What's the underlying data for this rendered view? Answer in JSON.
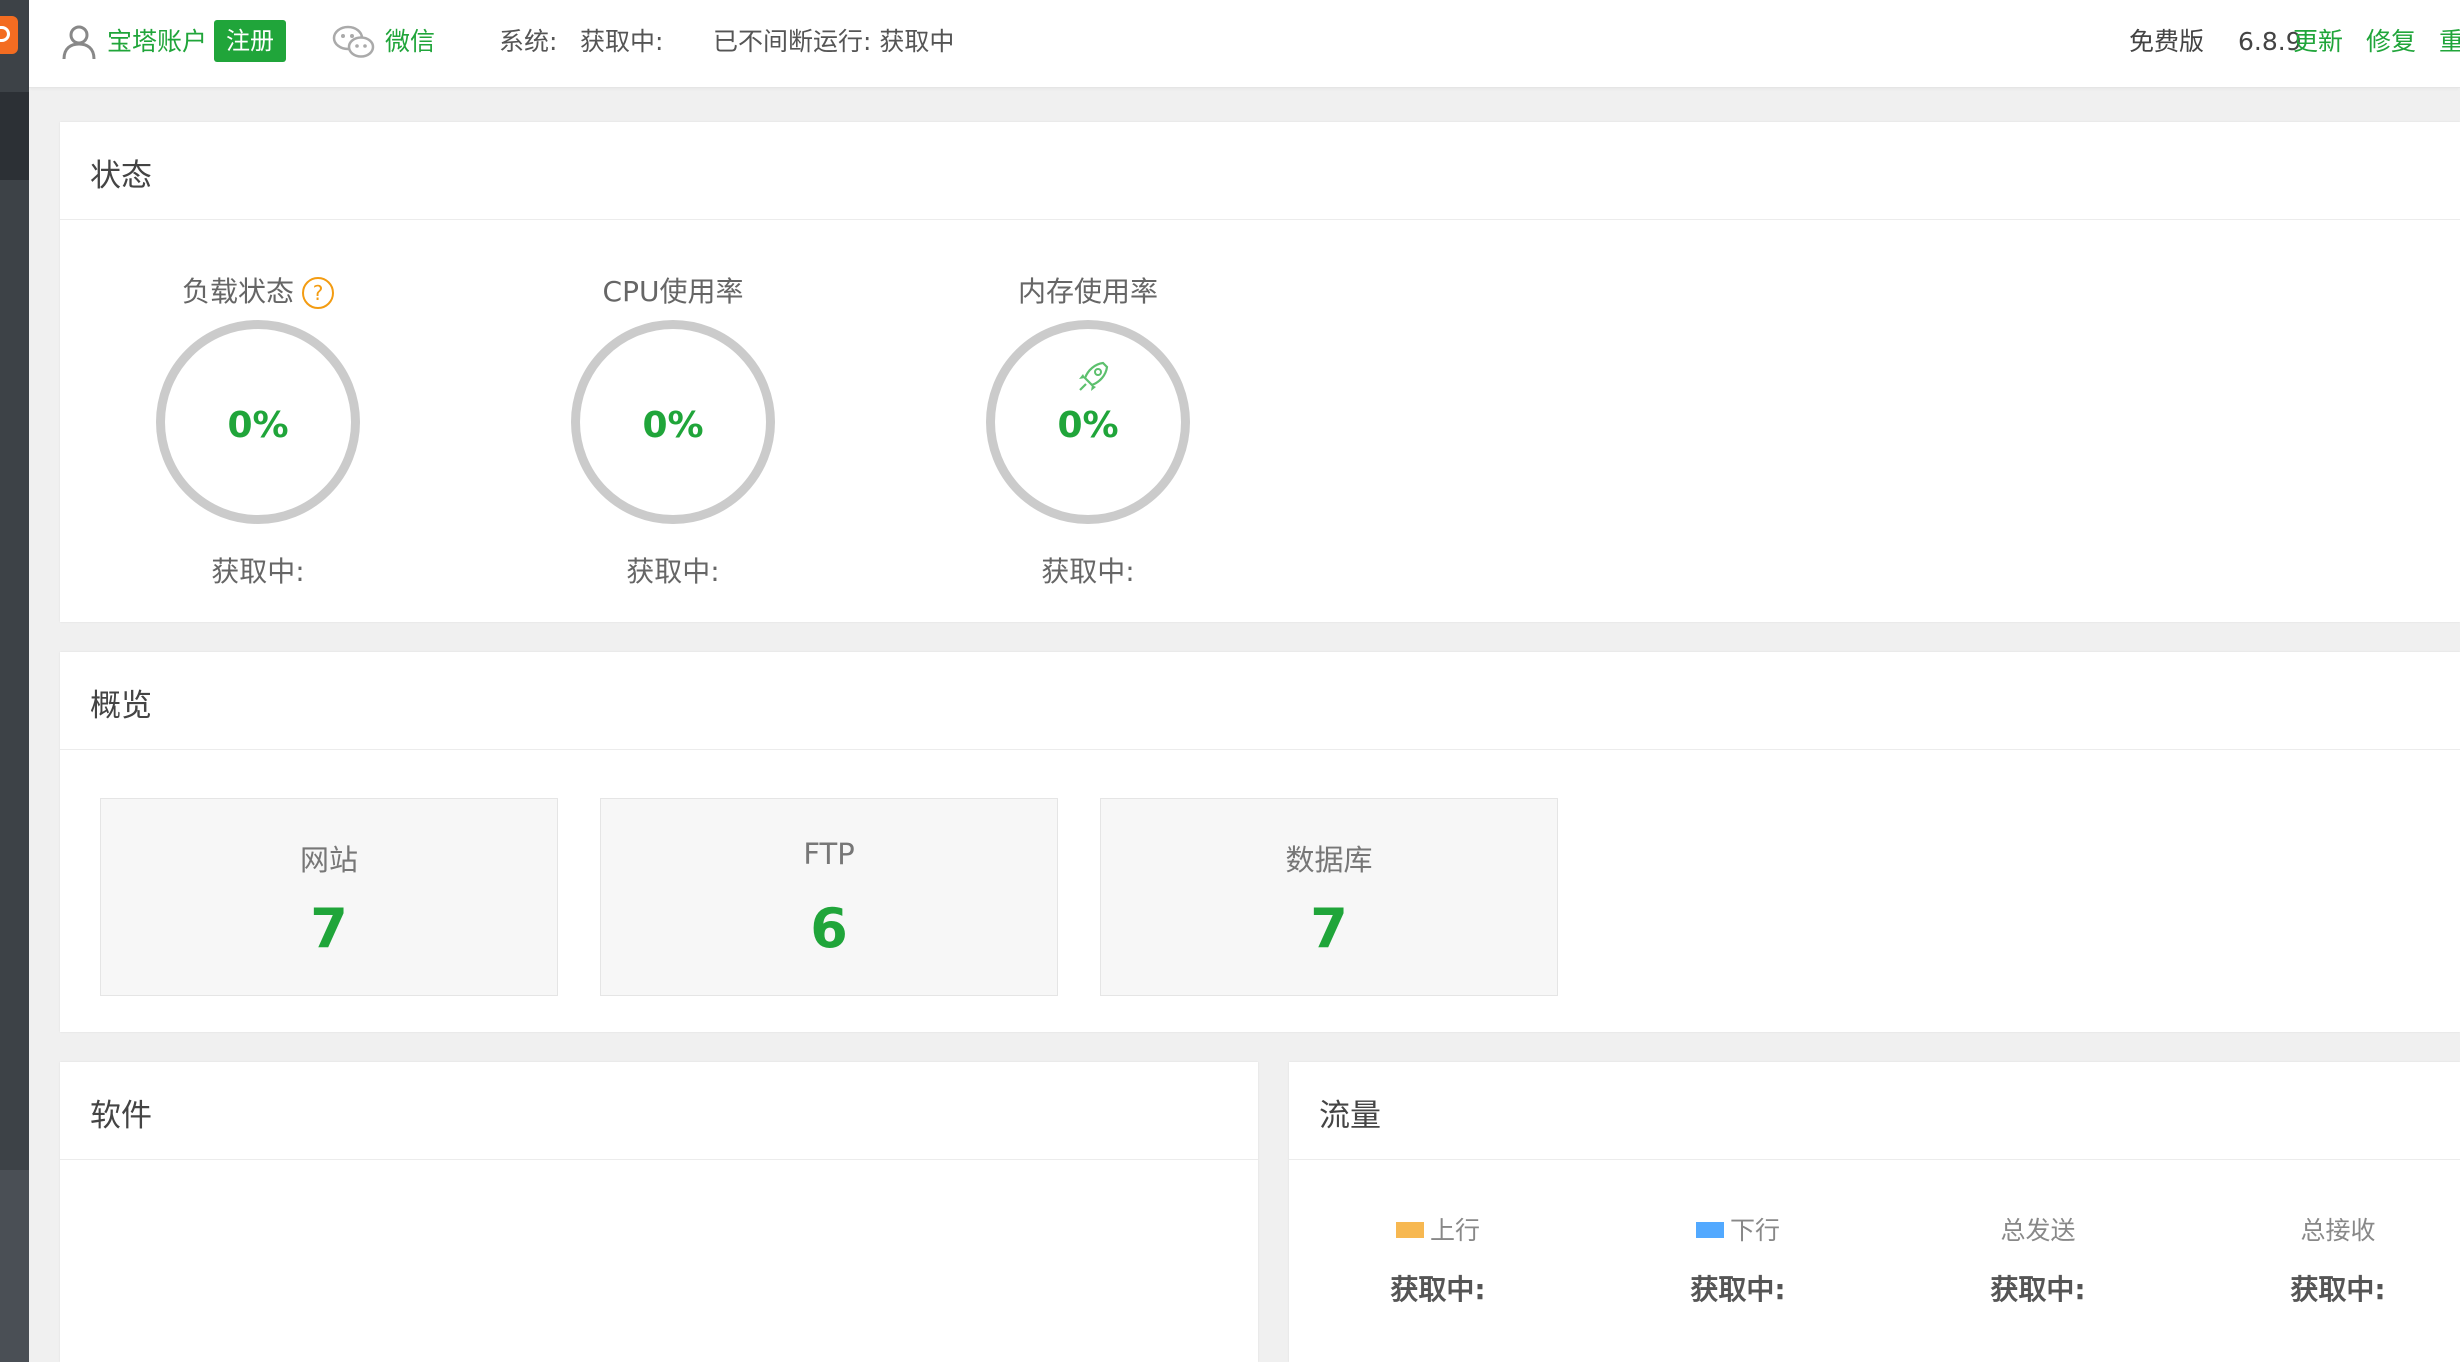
{
  "header": {
    "account": "宝塔账户",
    "register": "注册",
    "wechat": "微信",
    "system_label": "系统:",
    "system_value": "获取中:",
    "uptime": "已不间断运行: 获取中",
    "edition": "免费版",
    "version": "6.8.9",
    "update": "更新",
    "repair": "修复",
    "restart": "重"
  },
  "status": {
    "title": "状态",
    "gauges": [
      {
        "label": "负载状态",
        "value": "0%",
        "sub": "获取中:"
      },
      {
        "label": "CPU使用率",
        "value": "0%",
        "sub": "获取中:"
      },
      {
        "label": "内存使用率",
        "value": "0%",
        "sub": "获取中:"
      }
    ],
    "help_icon_text": "?"
  },
  "overview": {
    "title": "概览",
    "boxes": [
      {
        "label": "网站",
        "count": "7"
      },
      {
        "label": "FTP",
        "count": "6"
      },
      {
        "label": "数据库",
        "count": "7"
      }
    ]
  },
  "software": {
    "title": "软件"
  },
  "traffic": {
    "title": "流量",
    "columns": [
      {
        "label": "上行",
        "value": "获取中:",
        "swatch": "#f7b851"
      },
      {
        "label": "下行",
        "value": "获取中:",
        "swatch": "#52a9ff"
      },
      {
        "label": "总发送",
        "value": "获取中:"
      },
      {
        "label": "总接收",
        "value": "获取中:"
      }
    ]
  },
  "colors": {
    "accent": "#20a53a",
    "warning": "#f39c12",
    "brand": "#f36c21"
  }
}
